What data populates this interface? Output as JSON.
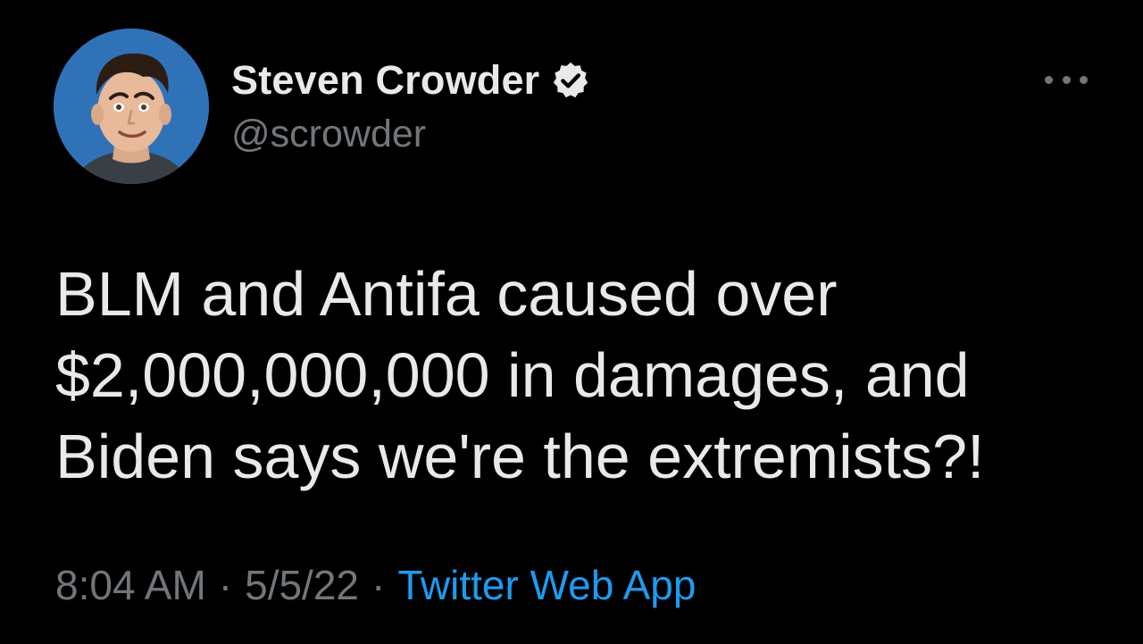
{
  "author": {
    "display_name": "Steven Crowder",
    "handle": "@scrowder",
    "verified": true,
    "avatar_icon": "profile-photo"
  },
  "tweet": {
    "lines": [
      "BLM and Antifa caused over",
      "$2,000,000,000 in damages, and",
      "Biden says we're the extremists?!"
    ]
  },
  "meta": {
    "time": "8:04 AM",
    "separator": "·",
    "date": "5/5/22",
    "source": "Twitter Web App"
  },
  "icons": {
    "verified": "verified-badge-icon",
    "more": "more-options-icon"
  },
  "colors": {
    "background": "#000000",
    "primary_text": "#e7e9ea",
    "secondary_text": "#71767b",
    "link": "#1d9bf0",
    "avatar_bg": "#2f72b8"
  }
}
